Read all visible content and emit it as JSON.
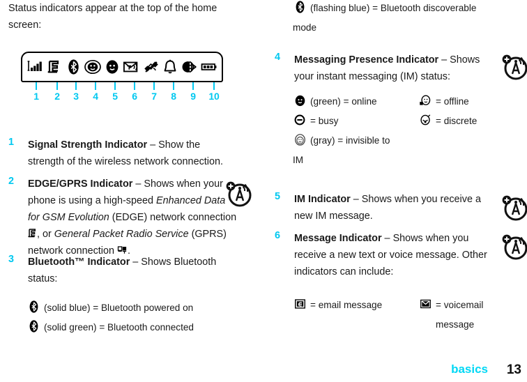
{
  "intro": {
    "text": "Status indicators appear at the top of the home screen:"
  },
  "figure": {
    "caption_numbers": [
      "1",
      "2",
      "3",
      "4",
      "5",
      "6",
      "7",
      "8",
      "9",
      "10"
    ],
    "icons": [
      {
        "n": "1",
        "name": "signal-strength-icon"
      },
      {
        "n": "2",
        "name": "edge-gprs-icon"
      },
      {
        "n": "3",
        "name": "bluetooth-icon"
      },
      {
        "n": "4",
        "name": "im-presence-icon"
      },
      {
        "n": "5",
        "name": "im-message-icon"
      },
      {
        "n": "6",
        "name": "message-icon"
      },
      {
        "n": "7",
        "name": "location-satellite-icon"
      },
      {
        "n": "8",
        "name": "ringer-bell-icon"
      },
      {
        "n": "9",
        "name": "call-forward-icon"
      },
      {
        "n": "10",
        "name": "battery-icon"
      }
    ],
    "tick_color": "#00c8f0",
    "number_color": "#00c8f0",
    "outline_color": "#000000"
  },
  "items": [
    {
      "number": "1",
      "title": "Signal Strength Indicator",
      "dash": " – ",
      "body": "Show the strength of the wireless network connection."
    },
    {
      "number": "2",
      "title": "EDGE/GPRS Indicator",
      "dash": " – ",
      "body_1": "Shows when your phone is using a high-speed ",
      "italic_1": "Enhanced Data for GSM Evolution",
      "body_2": " (EDGE) network connection ",
      "body_3": ", or ",
      "italic_2": "General Packet Radio Service",
      "body_4": " (GPRS) network connection ",
      "body_5": "."
    },
    {
      "number": "3",
      "title": "Bluetooth™ Indicator",
      "dash": " – ",
      "body": "Shows Bluetooth status:",
      "defs": [
        {
          "glyph": "bluetooth-icon",
          "text": "(solid blue) = Bluetooth powered on"
        },
        {
          "glyph": "bluetooth-icon",
          "text": "(solid green) = Bluetooth connected"
        },
        {
          "glyph": "bluetooth-icon",
          "text": "(flashing blue) = Bluetooth discoverable"
        },
        {
          "glyph": "",
          "text": "mode"
        }
      ]
    },
    {
      "number": "4",
      "title": "Messaging Presence Indicator",
      "dash": " – ",
      "body": "Shows your instant messaging (IM) status:",
      "defs_left": [
        {
          "glyph": "presence-online-icon",
          "text": "(green) = online"
        },
        {
          "glyph": "presence-busy-icon",
          "text": "= busy"
        },
        {
          "glyph": "presence-invisible-icon",
          "text": "(gray) = invisible to"
        }
      ],
      "defs_left_wrap": "IM",
      "defs_right": [
        {
          "glyph": "presence-offline-icon",
          "text": "= offline"
        },
        {
          "glyph": "presence-discrete-icon",
          "text": "= discrete"
        }
      ]
    },
    {
      "number": "5",
      "title": "IM Indicator",
      "dash": " – ",
      "body": "Shows when you receive a new IM message."
    },
    {
      "number": "6",
      "title": "Message Indicator",
      "dash": " – ",
      "body": "Shows when you receive a new text or voice message. Other indicators can include:",
      "defs_left": [
        {
          "glyph": "email-message-icon",
          "text": "= email message"
        }
      ],
      "defs_right": [
        {
          "glyph": "voicemail-message-icon",
          "text": "= voicemail"
        }
      ],
      "defs_right_wrap": "message"
    }
  ],
  "tips": {
    "icon_name": "tip-antenna-icon",
    "count": 4
  },
  "footer": {
    "section": "basics",
    "page": "13"
  }
}
